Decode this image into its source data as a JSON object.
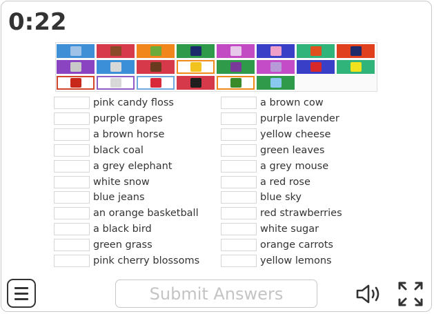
{
  "timer": "0:22",
  "tiles": [
    {
      "bg": "#3f8fd6",
      "pic": "#9ec2e8"
    },
    {
      "bg": "#d73a4a",
      "pic": "#8a4a2a"
    },
    {
      "bg": "#f0861c",
      "pic": "#6caa3a"
    },
    {
      "bg": "#2e9a4a",
      "pic": "#1b2a6a"
    },
    {
      "bg": "#c24bc4",
      "pic": "#e8c8ea"
    },
    {
      "bg": "#3a3fc8",
      "pic": "#f0a0c8"
    },
    {
      "bg": "#30b47a",
      "pic": "#e0501e"
    },
    {
      "bg": "#e0401e",
      "pic": "#1e2a6a"
    },
    {
      "bg": "#8a44c2",
      "pic": "#c8c8c8"
    },
    {
      "bg": "#3a8fd8",
      "pic": "#d8d8d8"
    },
    {
      "bg": "#d63a4a",
      "pic": "#6a3a1e"
    },
    {
      "bg": "#ffffff",
      "pic": "#f2c21e"
    },
    {
      "bg": "#2e9a4a",
      "pic": "#7a3a9a"
    },
    {
      "bg": "#c44cc6",
      "pic": "#b89ad8"
    },
    {
      "bg": "#3a3fc8",
      "pic": "#d8282a"
    },
    {
      "bg": "#30b47a",
      "pic": "#f2e21e"
    },
    {
      "bg": "#ffffff",
      "pic": "#c8281a"
    },
    {
      "bg": "#ffffff",
      "pic": "#d8d8d8"
    },
    {
      "bg": "#ffffff",
      "pic": "#d8283a"
    },
    {
      "bg": "#d63a4a",
      "pic": "#1e1e1e"
    },
    {
      "bg": "#ffffff",
      "pic": "#3a8a2a"
    },
    {
      "bg": "#2e9a4a",
      "pic": "#8ac8f0"
    }
  ],
  "left_items": [
    "pink candy floss",
    "purple grapes",
    "a brown horse",
    "black coal",
    "a grey elephant",
    "white snow",
    "blue jeans",
    "an orange basketball",
    "a black bird",
    "green grass",
    "pink cherry blossoms"
  ],
  "right_items": [
    "a brown cow",
    "purple lavender",
    "yellow cheese",
    "green leaves",
    "a grey mouse",
    "a red rose",
    "blue sky",
    "red strawberries",
    "white sugar",
    "orange carrots",
    "yellow lemons"
  ],
  "submit_label": "Submit Answers"
}
